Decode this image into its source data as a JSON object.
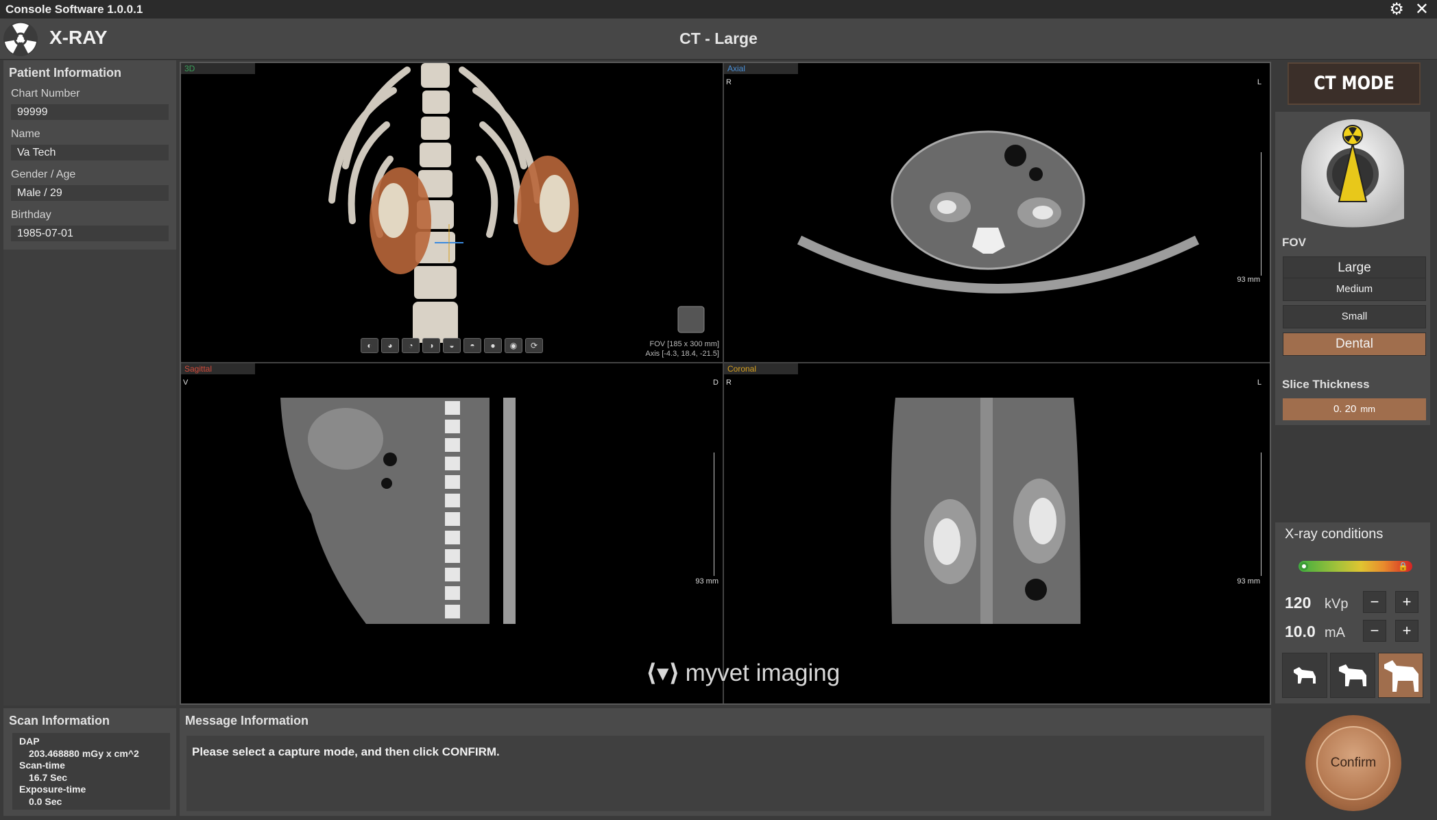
{
  "app": {
    "title": "Console Software  1.0.0.1",
    "brand": "X-RAY",
    "page_title": "CT - Large"
  },
  "titlebar": {
    "settings_glyph": "⚙",
    "close_glyph": "✕"
  },
  "patient": {
    "heading": "Patient Information",
    "fields": [
      {
        "label": "Chart Number",
        "value": "99999"
      },
      {
        "label": "Name",
        "value": "Va Tech"
      },
      {
        "label": "Gender / Age",
        "value": "Male / 29"
      },
      {
        "label": "Birthday",
        "value": "1985-07-01"
      }
    ]
  },
  "scan": {
    "heading": "Scan Information",
    "dap_label": "DAP",
    "dap_value": "203.468880 mGy x cm^2",
    "scantime_label": "Scan-time",
    "scantime_value": "16.7 Sec",
    "exposure_label": "Exposure-time",
    "exposure_value": "0.0 Sec"
  },
  "viewports": {
    "v3d": {
      "tab": "3D",
      "tab_color": "#3aa05a",
      "fov_text": "FOV [185 x 300 mm]",
      "axis_text": "Axis [-4.3, 18.4, -21.5]"
    },
    "axial": {
      "tab": "Axial",
      "tab_color": "#4a8fd6",
      "left": "R",
      "right": "L",
      "scale": "93 mm"
    },
    "sagittal": {
      "tab": "Sagittal",
      "tab_color": "#d24a3a",
      "left": "V",
      "right": "D",
      "scale": "93 mm"
    },
    "coronal": {
      "tab": "Coronal",
      "tab_color": "#d6a020",
      "left": "R",
      "right": "L",
      "scale": "93 mm"
    }
  },
  "watermark": {
    "icon": "⟨▾⟩",
    "text": "myvet imaging"
  },
  "message": {
    "heading": "Message Information",
    "text": "Please select a capture mode, and then click CONFIRM."
  },
  "ct": {
    "mode_label": "CT MODE",
    "fov_label": "FOV",
    "fov_options": [
      "Large",
      "Medium",
      "Small",
      "Dental"
    ],
    "fov_selected": "Dental",
    "slice_label": "Slice Thickness",
    "slice_value": "0. 20",
    "slice_unit": "mm"
  },
  "xray": {
    "title": "X-ray conditions",
    "kvp_value": "120",
    "kvp_unit": "kVp",
    "ma_value": "10.0",
    "ma_unit": "mA",
    "minus": "−",
    "plus": "+",
    "dose_level_fraction": 0.0,
    "dog_sizes": [
      "small-dog-icon",
      "medium-dog-icon",
      "large-dog-icon"
    ],
    "dog_selected": 2
  },
  "confirm": {
    "label": "Confirm"
  },
  "colors": {
    "accent": "#a06e4d",
    "panel": "#4a4a4a",
    "dark": "#3a3a3a"
  }
}
